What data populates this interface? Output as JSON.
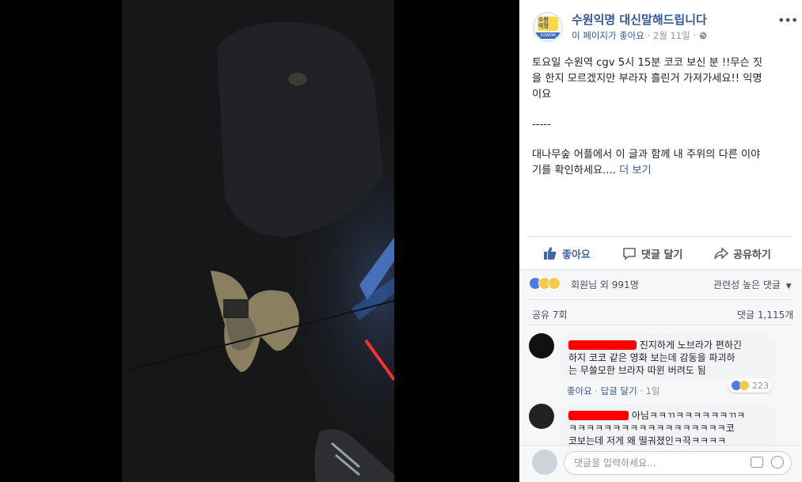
{
  "page": {
    "name": "수원익명 대신말해드립니다",
    "follow_text": "이 페이지가 좋아요",
    "date": "2월 11일",
    "logo_top": "수원\n익명",
    "logo_bottom": "SUWON"
  },
  "post": {
    "line1": "토요일 수원역 cgv 5시 15분 코코 보신 분 !!무슨 짓",
    "line2": "을 한지 모르겠지만 부라자 흘린거 가져가세요!! 익명",
    "line3": "이요",
    "separator": "-----",
    "line4": "대나무숲 어플에서 이 글과 함께 내 주위의 다른 이야",
    "line5": "기를 확인하세요....",
    "see_more": "더 보기"
  },
  "actions": {
    "like": "좋아요",
    "comment": "댓글 달기",
    "share": "공유하기"
  },
  "stats": {
    "reactions": "회원님 외 991명",
    "sort": "관련성 높은 댓글",
    "shares": "공유 7회",
    "comments": "댓글 1,115개"
  },
  "comments": [
    {
      "line1": "진지하게 노브라가 편하긴",
      "line2": "하지 코코 같은 영화 보는데 감동을 파괴하",
      "line3": "는 무쓸모한 브라자 따윈 버려도 됨",
      "like": "좋아요",
      "reply": "답글 달기",
      "time": "1일",
      "reaction_count": "223"
    },
    {
      "line1": "아님ㅋㅋㄲㅋㅋㅋㅋㅋㅋㄲㅋ",
      "line2": "ㅋㅋㅋㅋㅋㅋㅋㅋㅋㅋㅋㅋㅋㅋㅋㅋㅋㅋ코",
      "line3": "코보는데 저게 왜 떨궈졌인ㅋ끅ㅋㅋㅋㅋ"
    }
  ],
  "composer": {
    "placeholder": "댓글을 입력하세요..."
  },
  "colors": {
    "facebook_blue": "#365899",
    "like_blue": "#4267b2",
    "redaction": "#ff0000"
  }
}
